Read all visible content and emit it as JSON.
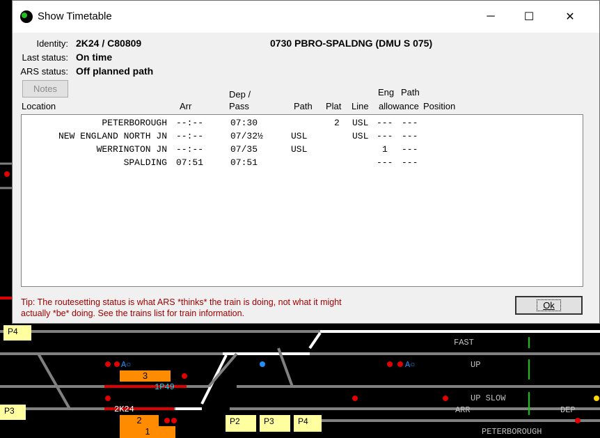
{
  "window": {
    "title": "Show Timetable",
    "minimize_glyph": "─",
    "maximize_glyph": "☐",
    "close_glyph": "✕"
  },
  "header": {
    "identity_label": "Identity:",
    "identity_value": "2K24 / C80809",
    "service": "0730 PBRO-SPALDNG (DMU S 075)",
    "last_status_label": "Last status:",
    "last_status_value": "On time",
    "ars_status_label": "ARS status:",
    "ars_status_value": "Off planned path"
  },
  "notes_button": "Notes",
  "columns": {
    "location": "Location",
    "arr": "Arr",
    "dep1": "Dep /",
    "dep2": "Pass",
    "path": "Path",
    "plat": "Plat",
    "line": "Line",
    "eng1": "Eng",
    "eng2": "allowance",
    "pathpos1": "Path",
    "pathpos2": "Position"
  },
  "rows": [
    {
      "location": "PETERBOROUGH",
      "arr": "--:--",
      "dep": "07:30",
      "path": "",
      "plat": "2",
      "line": "USL",
      "eng": "---",
      "pos": "---"
    },
    {
      "location": "NEW ENGLAND NORTH JN",
      "arr": "--:--",
      "dep": "07/32½",
      "path": "USL",
      "plat": "",
      "line": "USL",
      "eng": "---",
      "pos": "---"
    },
    {
      "location": "WERRINGTON JN",
      "arr": "--:--",
      "dep": "07/35",
      "path": "USL",
      "plat": "",
      "line": "",
      "eng": "1",
      "pos": "---"
    },
    {
      "location": "SPALDING",
      "arr": "07:51",
      "dep": "07:51",
      "path": "",
      "plat": "",
      "line": "",
      "eng": "---",
      "pos": "---"
    }
  ],
  "tip": "Tip: The routesetting status is what ARS *thinks* the train is doing, not what it might actually *be* doing. See the trains list for train information.",
  "ok_button": "Ok",
  "background_panel": {
    "platforms": [
      "P4",
      "P3",
      "P2",
      "P3",
      "P4"
    ],
    "berths": [
      "3",
      "2",
      "1"
    ],
    "train_labels": [
      "1P49",
      "2K24"
    ],
    "line_labels": [
      "FAST",
      "UP",
      "UP SLOW",
      "ARR",
      "DEP",
      "PETERBOROUGH"
    ],
    "signal_marks": [
      "A○",
      "A○"
    ]
  },
  "colors": {
    "tip_text": "#a00000",
    "track_red": "#e00000",
    "berth_orange": "#ff8c00",
    "platform_yellow": "#ffffa0",
    "track_grey": "#808080",
    "track_white": "#ffffff",
    "train_cyan": "#00e0ff"
  }
}
